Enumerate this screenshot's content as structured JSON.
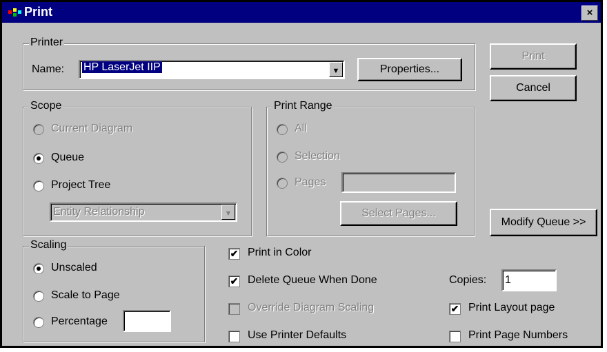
{
  "window": {
    "title": "Print",
    "close": "×"
  },
  "printer": {
    "group_label": "Printer",
    "name_label": "Name:",
    "name_value": "HP LaserJet IIP",
    "properties_label": "Properties..."
  },
  "buttons": {
    "print": "Print",
    "cancel": "Cancel",
    "modify_queue": "Modify Queue >>",
    "select_pages": "Select Pages..."
  },
  "scope": {
    "group_label": "Scope",
    "current_diagram": "Current Diagram",
    "queue": "Queue",
    "project_tree": "Project Tree",
    "tree_type": "Entity Relationship",
    "selected": "Queue"
  },
  "print_range": {
    "group_label": "Print Range",
    "all": "All",
    "selection": "Selection",
    "pages": "Pages",
    "pages_value": ""
  },
  "scaling": {
    "group_label": "Scaling",
    "unscaled": "Unscaled",
    "scale_to_page": "Scale to Page",
    "percentage": "Percentage",
    "percentage_value": "",
    "selected": "Unscaled"
  },
  "options": {
    "print_in_color": {
      "label": "Print in Color",
      "checked": true
    },
    "delete_queue": {
      "label": "Delete Queue When Done",
      "checked": true
    },
    "override_scaling": {
      "label": "Override Diagram Scaling",
      "checked": false
    },
    "use_printer_defaults": {
      "label": "Use Printer Defaults",
      "checked": false
    },
    "print_layout_page": {
      "label": "Print Layout page",
      "checked": true
    },
    "print_page_numbers": {
      "label": "Print Page Numbers",
      "checked": false
    }
  },
  "copies": {
    "label": "Copies:",
    "value": "1"
  },
  "check_glyph": "✔",
  "combo_arrow": "▼"
}
